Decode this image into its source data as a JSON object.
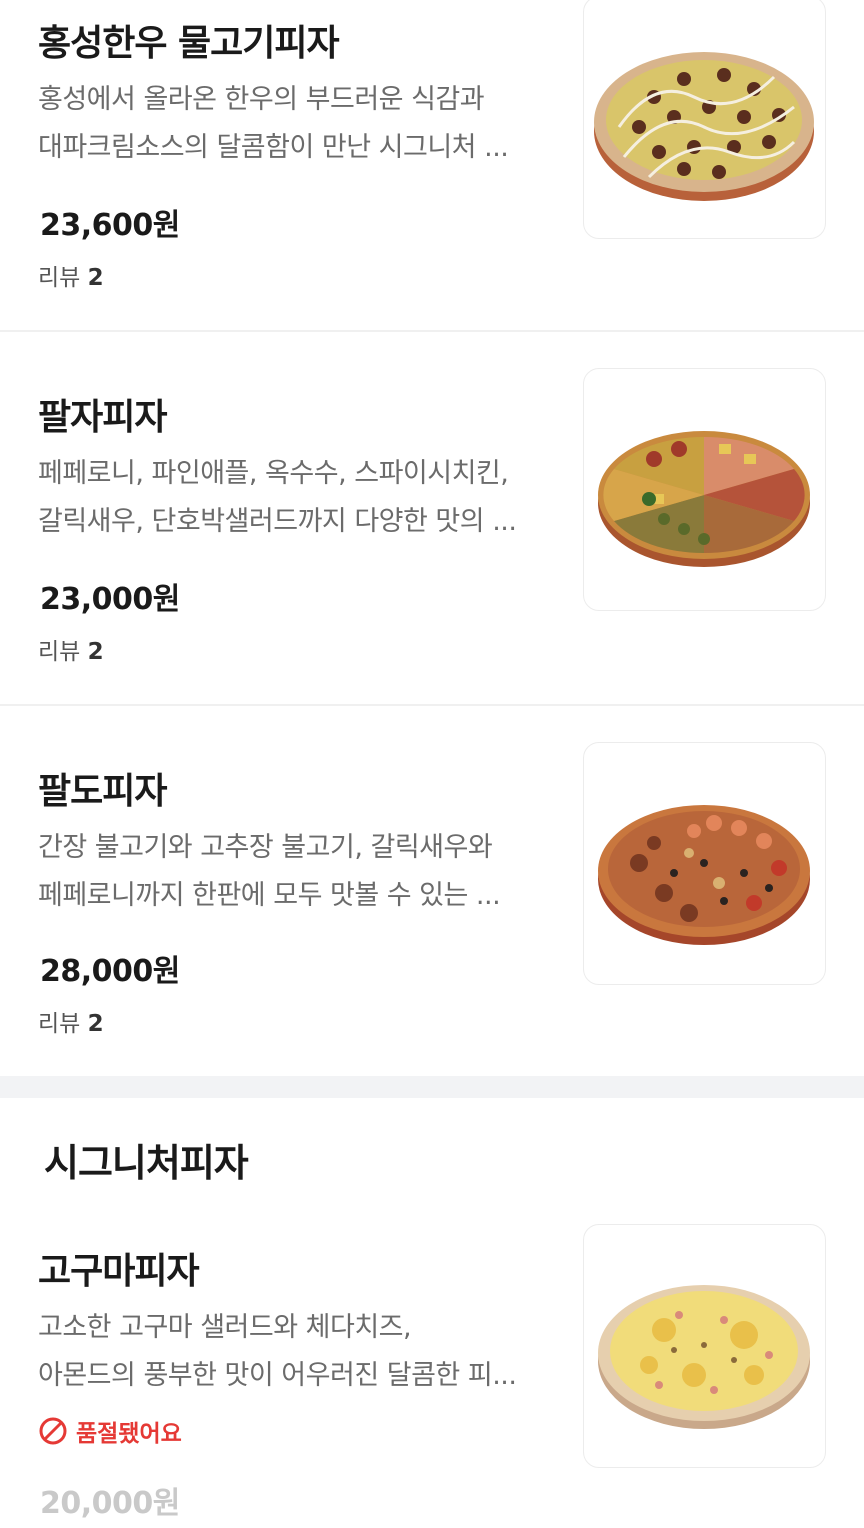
{
  "items": [
    {
      "name": "홍성한우 물고기피자",
      "desc_line1": "홍성에서 올라온 한우의 부드러운 식감과",
      "desc_line2": "대파크림소스의 달콤함이 만난 시그니처 ...",
      "price": "23,600원",
      "review_label": "리뷰",
      "review_count": "2",
      "image_icon": "pizza-image"
    },
    {
      "name": "팔자피자",
      "desc_line1": "페페로니, 파인애플, 옥수수, 스파이시치킨,",
      "desc_line2": "갈릭새우, 단호박샐러드까지 다양한 맛의 ...",
      "price": "23,000원",
      "review_label": "리뷰",
      "review_count": "2",
      "image_icon": "pizza-image"
    },
    {
      "name": "팔도피자",
      "desc_line1": "간장 불고기와 고추장 불고기, 갈릭새우와",
      "desc_line2": "페페로니까지 한판에 모두 맛볼 수 있는 ...",
      "price": "28,000원",
      "review_label": "리뷰",
      "review_count": "2",
      "image_icon": "pizza-image"
    }
  ],
  "section": {
    "title": "시그니처피자",
    "items": [
      {
        "name": "고구마피자",
        "desc_line1": "고소한 고구마 샐러드와 체다치즈,",
        "desc_line2": "아몬드의 풍부한 맛이 어우러진 달콤한 피...",
        "soldout_label": "품절됐어요",
        "price": "20,000원",
        "image_icon": "pizza-image"
      }
    ]
  },
  "colors": {
    "soldout": "#e53935",
    "text_primary": "#1a1a1a",
    "text_secondary": "#6b6b6b",
    "price_faded": "#c9c9c9",
    "section_gap": "#f2f3f5"
  },
  "icons": {
    "soldout": "prohibited-icon"
  }
}
